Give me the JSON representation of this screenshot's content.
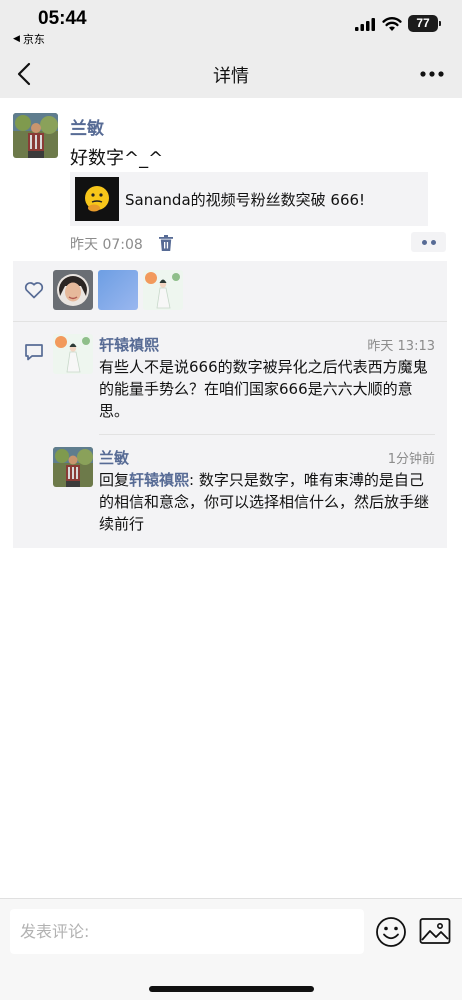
{
  "status_bar": {
    "time": "05:44",
    "back_app": "京东",
    "battery": "77"
  },
  "nav": {
    "title": "详情"
  },
  "post": {
    "author": "兰敏",
    "text": "好数字^_^",
    "link_title": "Sananda的视频号粉丝数突破 666!",
    "time": "昨天 07:08"
  },
  "comments": [
    {
      "author": "轩辕禛熙",
      "time": "昨天 13:13",
      "text": "有些人不是说666的数字被异化之后代表西方魔鬼的能量手势么？在咱们国家666是六六大顺的意思。"
    },
    {
      "author": "兰敏",
      "time": "1分钟前",
      "reply_prefix": "回复",
      "reply_to": "轩辕禛熙",
      "text": ": 数字只是数字，唯有束溥的是自己的相信和意念，你可以选择相信什么，然后放手继续前行"
    }
  ],
  "input": {
    "placeholder": "发表评论:"
  },
  "colors": {
    "link_blue": "#576b95",
    "nav_bg": "#ededed",
    "card_bg": "#f3f3f5"
  }
}
